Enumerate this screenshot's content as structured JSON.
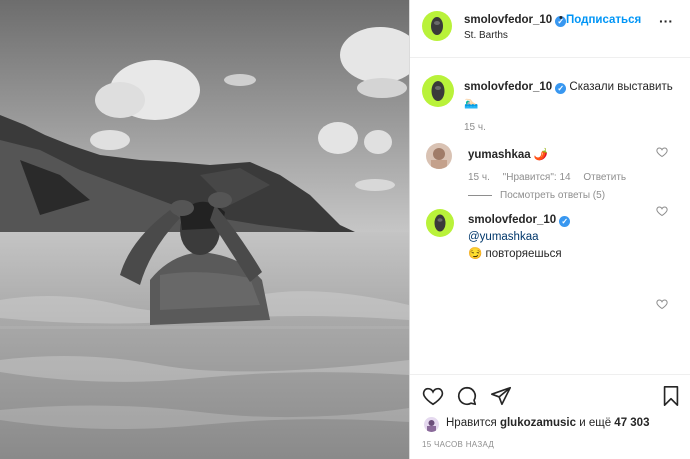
{
  "post": {
    "username": "smolovfedor_10",
    "follow_label": "Подписаться",
    "location": "St. Barths",
    "more_label": "···",
    "separator": "•"
  },
  "caption": {
    "username": "smolovfedor_10",
    "text": "Сказали выставить🏊🏻‍♂️",
    "time": "15 ч."
  },
  "comments": [
    {
      "username": "yumashkaa",
      "text": "🌶️",
      "time": "15 ч.",
      "likes": "\"Нравится\": 14",
      "reply_label": "Ответить",
      "view_replies": "Посмотреть ответы (5)"
    },
    {
      "username": "smolovfedor_10",
      "mention": "@yumashkaa",
      "text": "😏 повторяешься"
    }
  ],
  "likes": {
    "prefix": "Нравится",
    "user": "glukozamusic",
    "middle": "и ещё",
    "count": "47 303"
  },
  "posted": "15 ЧАСОВ НАЗАД",
  "colors": {
    "link_blue": "#0095f6",
    "verified": "#3897f0",
    "muted": "#8e8e8e",
    "avatar_bg": "#b9f23a"
  }
}
